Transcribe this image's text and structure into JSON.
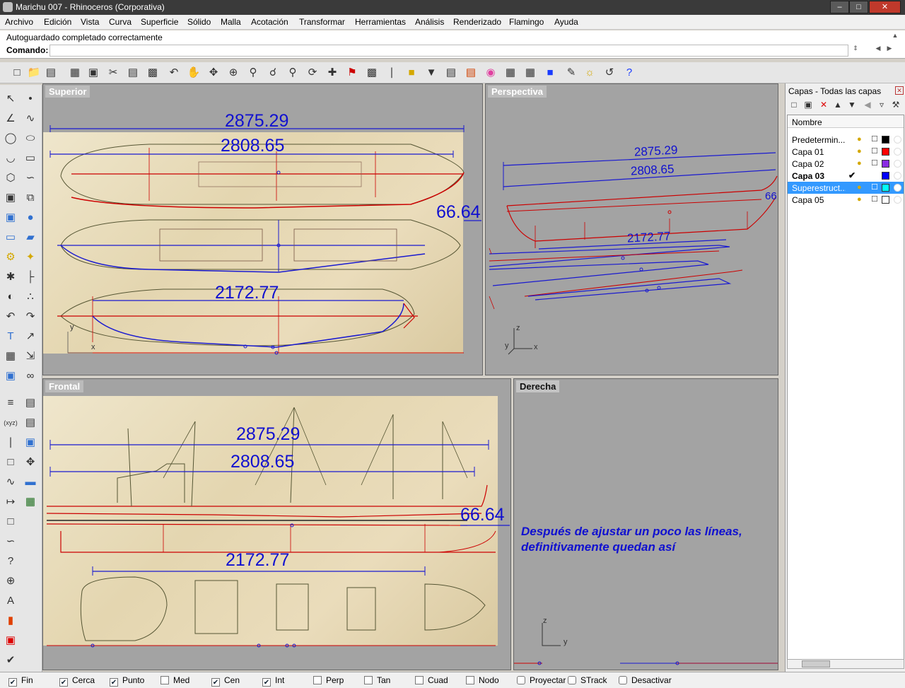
{
  "window": {
    "title": "Marichu 007 - Rhinoceros (Corporativa)",
    "minimize": "–",
    "maximize": "□",
    "close": "✕"
  },
  "menu": [
    "Archivo",
    "Edición",
    "Vista",
    "Curva",
    "Superficie",
    "Sólido",
    "Malla",
    "Acotación",
    "Transformar",
    "Herramientas",
    "Análisis",
    "Renderizado",
    "Flamingo",
    "Ayuda"
  ],
  "command": {
    "history": "Autoguardado completado correctamente",
    "prompt": "Comando:",
    "value": ""
  },
  "viewports": {
    "superior": {
      "label": "Superior",
      "dims": [
        "2875.29",
        "2808.65",
        "66.64",
        "2172.77"
      ]
    },
    "perspectiva": {
      "label": "Perspectiva",
      "dims": [
        "2875.29",
        "2808.65",
        "2172.77",
        "66"
      ]
    },
    "frontal": {
      "label": "Frontal",
      "dims": [
        "2875.29",
        "2808.65",
        "66.64",
        "2172.77"
      ]
    },
    "derecha": {
      "label": "Derecha",
      "annotation_line1": "Después de ajustar un poco las líneas,",
      "annotation_line2": "definitivamente quedan así"
    }
  },
  "axes": {
    "x": "x",
    "y": "y",
    "z": "z"
  },
  "layers": {
    "title": "Capas - Todas las capas",
    "column": "Nombre",
    "rows": [
      {
        "name": "Predetermin...",
        "color": "#000000",
        "current": false,
        "selected": false
      },
      {
        "name": "Capa 01",
        "color": "#ff0000",
        "current": false,
        "selected": false
      },
      {
        "name": "Capa 02",
        "color": "#8a2be2",
        "current": false,
        "selected": false
      },
      {
        "name": "Capa 03",
        "color": "#0000ff",
        "current": true,
        "selected": false
      },
      {
        "name": "Superestruct...",
        "color": "#00ffff",
        "current": false,
        "selected": true
      },
      {
        "name": "Capa 05",
        "color": "#ffffff",
        "current": false,
        "selected": false
      }
    ],
    "current_mark": "✔",
    "bulb_icon": "●",
    "lock_icon": "☐"
  },
  "osnaps": [
    {
      "label": "Fin",
      "checked": true
    },
    {
      "label": "Cerca",
      "checked": true
    },
    {
      "label": "Punto",
      "checked": true
    },
    {
      "label": "Med",
      "checked": false
    },
    {
      "label": "Cen",
      "checked": true
    },
    {
      "label": "Int",
      "checked": true
    },
    {
      "label": "Perp",
      "checked": false
    },
    {
      "label": "Tan",
      "checked": false
    },
    {
      "label": "Cuad",
      "checked": false
    },
    {
      "label": "Nodo",
      "checked": false
    }
  ],
  "status_buttons": [
    "Proyectar",
    "STrack",
    "Desactivar"
  ],
  "check_glyph": "✔"
}
